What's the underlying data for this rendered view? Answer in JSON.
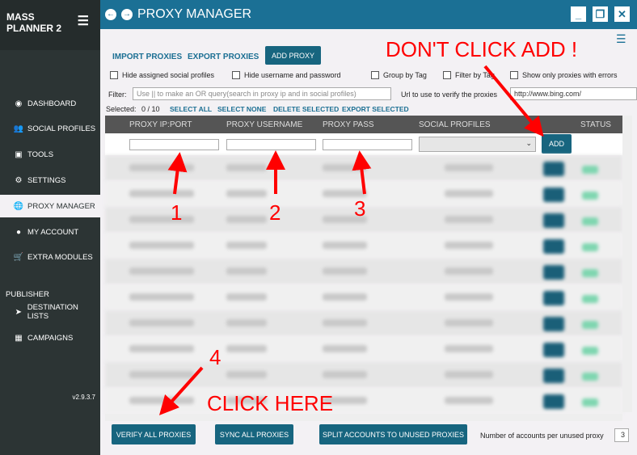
{
  "app": {
    "name": "MASS PLANNER 2",
    "version": "v2.9.3.7",
    "title": "PROXY MANAGER"
  },
  "sidebar": {
    "items": [
      {
        "label": "DASHBOARD",
        "icon": "compass-icon"
      },
      {
        "label": "SOCIAL PROFILES",
        "icon": "users-icon"
      },
      {
        "label": "TOOLS",
        "icon": "briefcase-icon"
      },
      {
        "label": "SETTINGS",
        "icon": "gear-icon"
      },
      {
        "label": "PROXY MANAGER",
        "icon": "globe-icon",
        "active": true
      },
      {
        "label": "MY ACCOUNT",
        "icon": "user-icon"
      },
      {
        "label": "EXTRA MODULES",
        "icon": "cart-icon"
      }
    ],
    "section": "PUBLISHER",
    "publisher_items": [
      {
        "label": "DESTINATION LISTS",
        "icon": "send-icon"
      },
      {
        "label": "CAMPAIGNS",
        "icon": "calendar-icon"
      }
    ]
  },
  "toolbar": {
    "import": "IMPORT PROXIES",
    "export": "EXPORT PROXIES",
    "add_proxy": "ADD PROXY"
  },
  "options": [
    "Hide assigned social profiles",
    "Hide username and password",
    "Group by Tag",
    "Filter by Tag",
    "Show only proxies with errors"
  ],
  "filter": {
    "label": "Filter:",
    "placeholder": "Use || to make an OR query(search in proxy ip and in social profiles)",
    "url_label": "Url to use to verify the proxies",
    "url_value": "http://www.bing.com/"
  },
  "selection": {
    "label": "Selected:",
    "count": "0 / 10",
    "select_all": "SELECT ALL",
    "select_none": "SELECT NONE",
    "delete": "DELETE SELECTED",
    "export": "EXPORT SELECTED"
  },
  "table": {
    "columns": [
      "PROXY IP:PORT",
      "PROXY USERNAME",
      "PROXY PASS",
      "SOCIAL PROFILES",
      "STATUS"
    ],
    "add": "ADD"
  },
  "footer": {
    "verify": "VERIFY ALL PROXIES",
    "sync": "SYNC ALL PROXIES",
    "split": "SPLIT ACCOUNTS TO UNUSED PROXIES",
    "accounts_label": "Number of accounts per unused proxy",
    "accounts_value": "3"
  },
  "annotations": {
    "dont": "DON'T CLICK ADD !",
    "click": "CLICK HERE",
    "n1": "1",
    "n2": "2",
    "n3": "3",
    "n4": "4",
    "color": "#ff0000"
  }
}
